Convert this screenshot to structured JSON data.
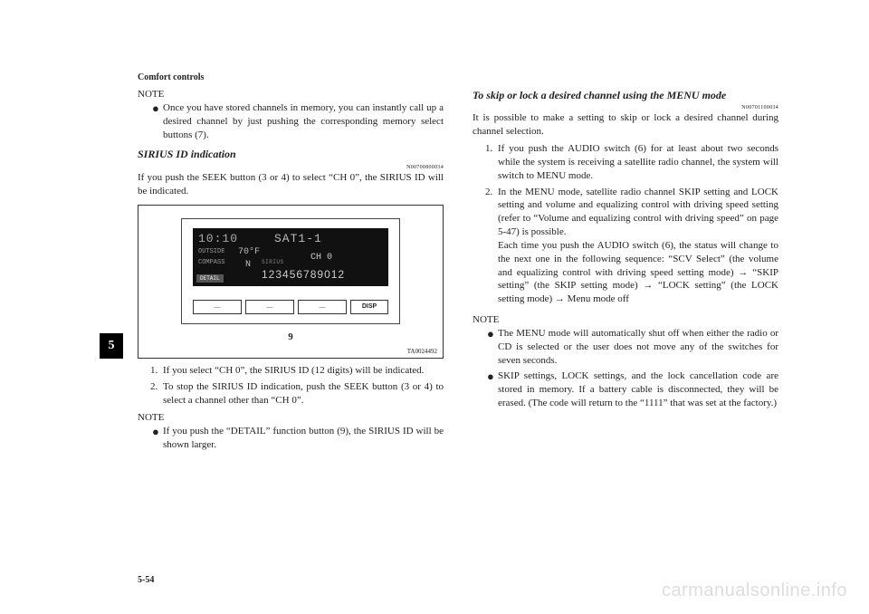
{
  "runningHead": "Comfort controls",
  "chapterTab": "5",
  "pageNumber": "5-54",
  "watermark": "carmanualsonline.info",
  "left": {
    "note1Label": "NOTE",
    "note1Bullet": "Once you have stored channels in memory, you can instantly call up a desired channel by just pushing the corresponding memory select buttons (7).",
    "siriusTitle": "SIRIUS ID indication",
    "siriusCode": "N00700800034",
    "siriusPara": "If you push the SEEK button (3 or 4) to select “CH 0”, the SIRIUS ID will be indicated.",
    "list1": "If you select “CH 0”, the SIRIUS ID (12 digits) will be indicated.",
    "list2": "To stop the SIRIUS ID indication, push the SEEK button (3 or 4) to select a channel other than “CH 0”.",
    "note2Label": "NOTE",
    "note2Bullet": "If you push the “DETAIL” function button (9), the SIRIUS ID will be shown larger."
  },
  "figure": {
    "clock": "10:10",
    "sat": "SAT1-1",
    "outside": "OUTSIDE",
    "temp": "70°F",
    "compass": "COMPASS",
    "nDir": "N",
    "sirius": "SIRIUS",
    "ch": "CH   0",
    "digits": "123456789012",
    "detail": "DETAIL",
    "disp": "DISP",
    "callout": "9",
    "code": "TA0024492"
  },
  "right": {
    "skipTitle": "To skip or lock a desired channel using the MENU mode",
    "skipCode": "N00701100034",
    "skipIntro": "It is possible to make a setting to skip or lock a desired channel during channel selection.",
    "skipList1": "If you push the AUDIO switch (6) for at least about two seconds while the system is receiving a satellite radio channel, the system will switch to MENU mode.",
    "skipList2a": "In the MENU mode, satellite radio channel SKIP setting and LOCK setting and volume and equalizing control with driving speed setting (refer to “Volume and equalizing control with driving speed” on page 5-47) is possible.",
    "skipList2b": "Each time you push the AUDIO switch (6), the status will change to the next one in the following sequence: “SCV Select” (the volume and equalizing control with driving speed setting mode) → “SKIP setting” (the SKIP setting mode) → “LOCK setting” (the LOCK setting mode) → Menu mode off",
    "note3Label": "NOTE",
    "note3Bullet1": "The MENU mode will automatically shut off when either the radio or CD is selected or the user does not move any of the switches for seven seconds.",
    "note3Bullet2": "SKIP settings, LOCK settings, and the lock cancellation code are stored in memory. If a battery cable is disconnected, they will be erased. (The code will return to the “1111” that was set at the factory.)"
  }
}
